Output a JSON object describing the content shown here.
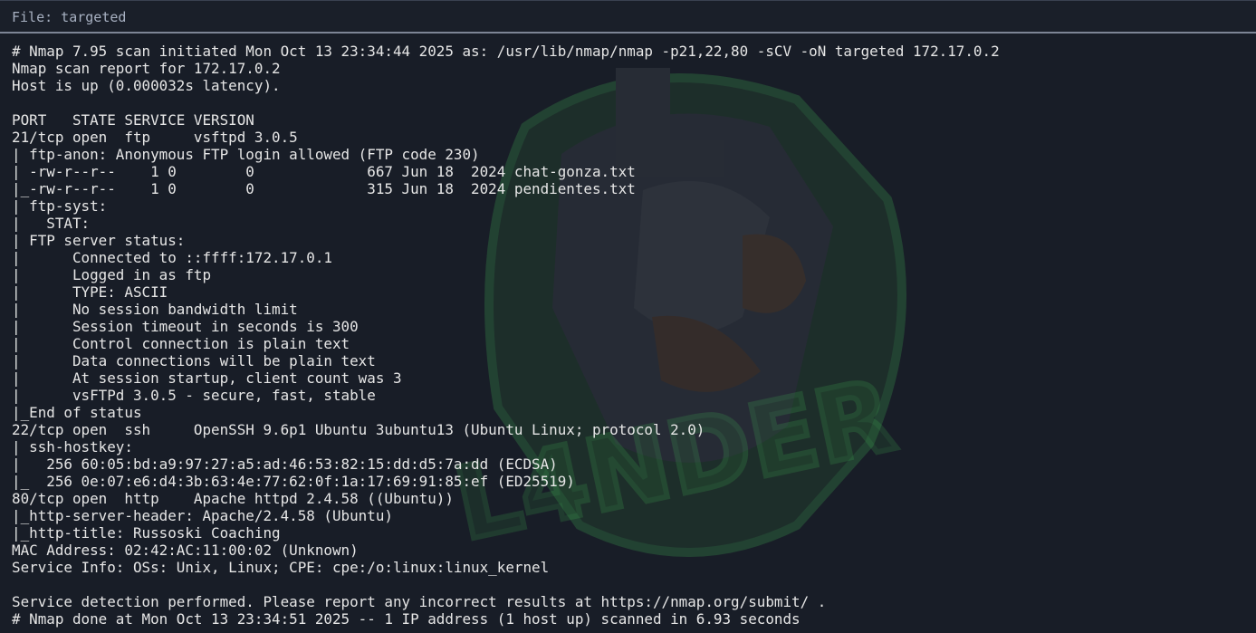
{
  "header": {
    "label": "File: targeted"
  },
  "background": {
    "logo_text": "L4NDER"
  },
  "terminal": {
    "lines": [
      "# Nmap 7.95 scan initiated Mon Oct 13 23:34:44 2025 as: /usr/lib/nmap/nmap -p21,22,80 -sCV -oN targeted 172.17.0.2",
      "Nmap scan report for 172.17.0.2",
      "Host is up (0.000032s latency).",
      "",
      "PORT   STATE SERVICE VERSION",
      "21/tcp open  ftp     vsftpd 3.0.5",
      "| ftp-anon: Anonymous FTP login allowed (FTP code 230)",
      "| -rw-r--r--    1 0        0             667 Jun 18  2024 chat-gonza.txt",
      "|_-rw-r--r--    1 0        0             315 Jun 18  2024 pendientes.txt",
      "| ftp-syst:",
      "|   STAT:",
      "| FTP server status:",
      "|      Connected to ::ffff:172.17.0.1",
      "|      Logged in as ftp",
      "|      TYPE: ASCII",
      "|      No session bandwidth limit",
      "|      Session timeout in seconds is 300",
      "|      Control connection is plain text",
      "|      Data connections will be plain text",
      "|      At session startup, client count was 3",
      "|      vsFTPd 3.0.5 - secure, fast, stable",
      "|_End of status",
      "22/tcp open  ssh     OpenSSH 9.6p1 Ubuntu 3ubuntu13 (Ubuntu Linux; protocol 2.0)",
      "| ssh-hostkey:",
      "|   256 60:05:bd:a9:97:27:a5:ad:46:53:82:15:dd:d5:7a:dd (ECDSA)",
      "|_  256 0e:07:e6:d4:3b:63:4e:77:62:0f:1a:17:69:91:85:ef (ED25519)",
      "80/tcp open  http    Apache httpd 2.4.58 ((Ubuntu))",
      "|_http-server-header: Apache/2.4.58 (Ubuntu)",
      "|_http-title: Russoski Coaching",
      "MAC Address: 02:42:AC:11:00:02 (Unknown)",
      "Service Info: OSs: Unix, Linux; CPE: cpe:/o:linux:linux_kernel",
      "",
      "Service detection performed. Please report any incorrect results at https://nmap.org/submit/ .",
      "# Nmap done at Mon Oct 13 23:34:51 2025 -- 1 IP address (1 host up) scanned in 6.93 seconds"
    ]
  }
}
